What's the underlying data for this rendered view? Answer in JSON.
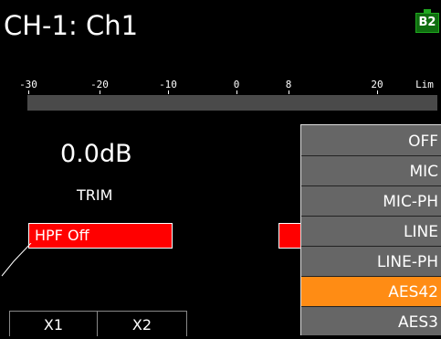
{
  "header": {
    "title": "CH-1: Ch1",
    "battery_badge": "B2",
    "badge_color": "#0f6e0f"
  },
  "meter": {
    "scale_labels": [
      "-30",
      "-20",
      "-10",
      "0",
      "8",
      "20",
      "Lim"
    ]
  },
  "trim": {
    "value": "0.0dB",
    "label": "TRIM"
  },
  "hpf": {
    "label": "HPF Off",
    "color": "#ff0000"
  },
  "tabs": [
    {
      "label": "X1"
    },
    {
      "label": "X2"
    }
  ],
  "input_menu": {
    "items": [
      {
        "label": "OFF"
      },
      {
        "label": "MIC"
      },
      {
        "label": "MIC-PH"
      },
      {
        "label": "LINE"
      },
      {
        "label": "LINE-PH"
      },
      {
        "label": "AES42"
      },
      {
        "label": "AES3"
      }
    ],
    "selected": "AES42",
    "highlight_color": "#ff8c14"
  }
}
